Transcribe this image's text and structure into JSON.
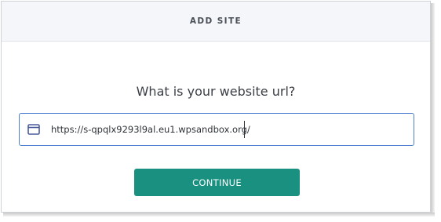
{
  "header": {
    "title": "ADD SITE"
  },
  "form": {
    "question": "What is your website url?",
    "url_value": "https://s-qpqlx9293l9al.eu1.wpsandbox.org/",
    "url_icon": "browser-window-icon",
    "continue_label": "CONTINUE"
  },
  "colors": {
    "accent": "#1a9081",
    "field_border": "#4d7fd0",
    "icon": "#4a5a9c",
    "header_bg": "#f4f6fa"
  }
}
